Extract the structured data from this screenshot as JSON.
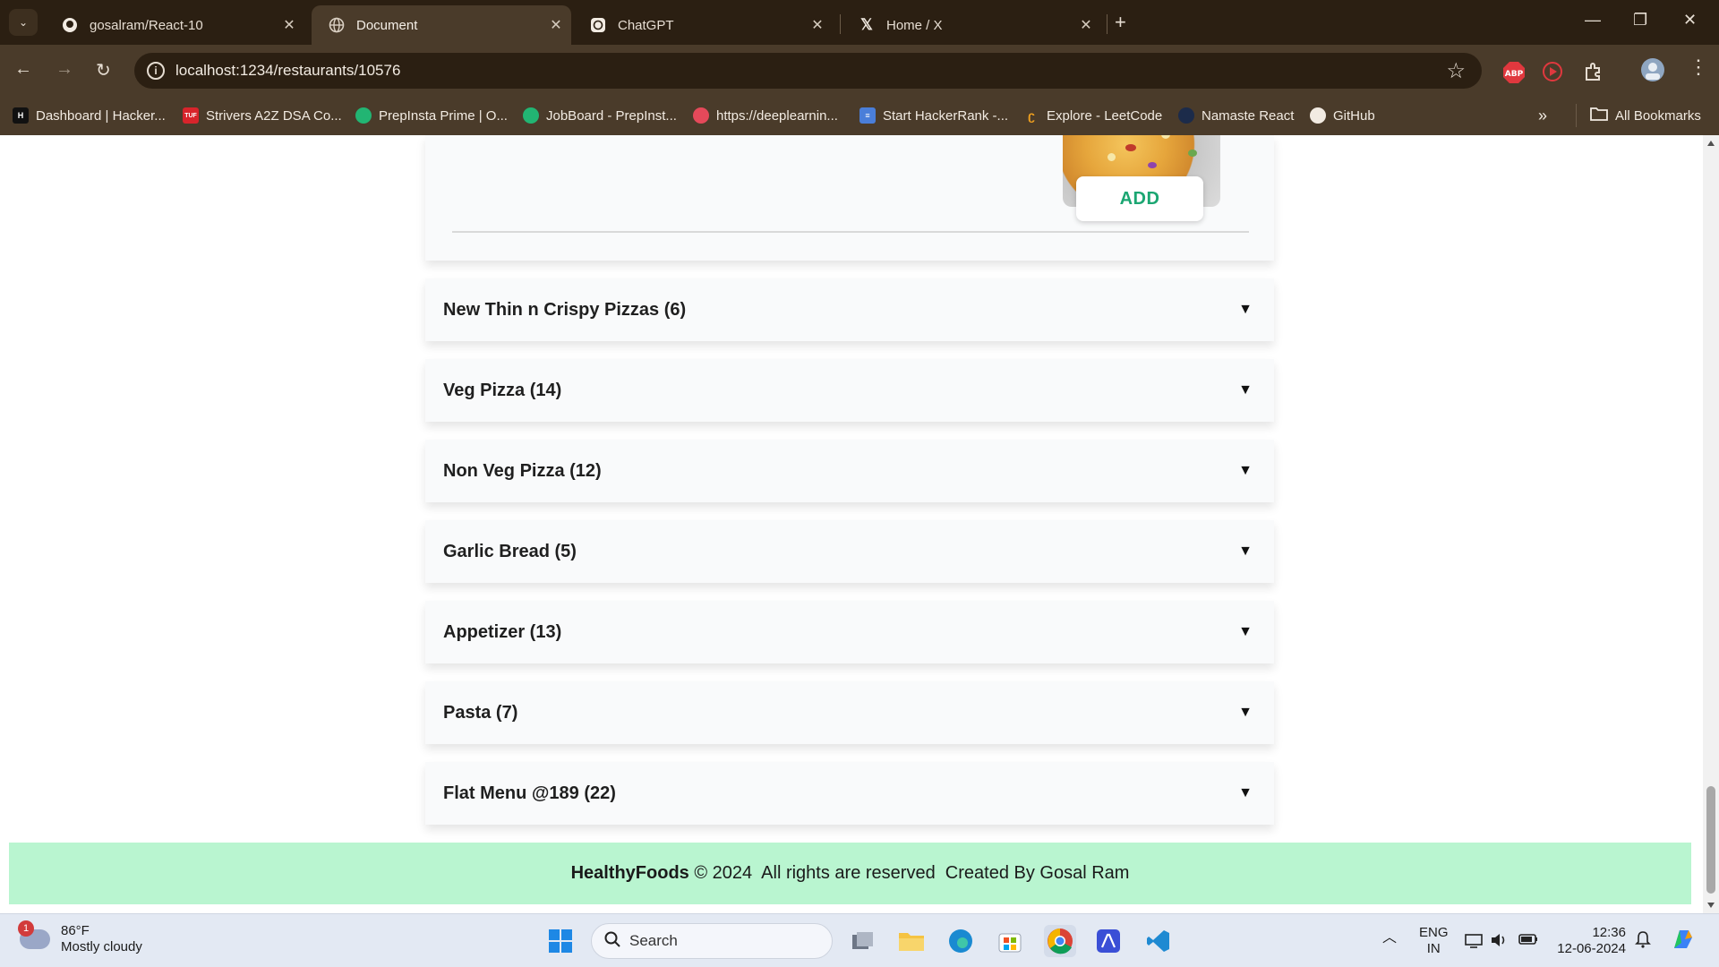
{
  "browser": {
    "tabs": [
      {
        "title": "gosalram/React-10",
        "icon": "github-icon",
        "active": false
      },
      {
        "title": "Document",
        "icon": "globe-icon",
        "active": true
      },
      {
        "title": "ChatGPT",
        "icon": "chatgpt-icon",
        "active": false
      },
      {
        "title": "Home / X",
        "icon": "x-icon",
        "active": false
      }
    ],
    "url": "localhost:1234/restaurants/10576",
    "bookmarks": [
      {
        "label": "Dashboard | Hacker...",
        "icon": "hackerrank-icon"
      },
      {
        "label": "Strivers A2Z DSA Co...",
        "icon": "takeuforward-icon"
      },
      {
        "label": "PrepInsta Prime | O...",
        "icon": "prepinsta-icon"
      },
      {
        "label": "JobBoard - PrepInst...",
        "icon": "prepinsta-icon"
      },
      {
        "label": "https://deeplearnin...",
        "icon": "deeplearning-icon"
      },
      {
        "label": "Start HackerRank -...",
        "icon": "doc-icon"
      },
      {
        "label": "Explore - LeetCode",
        "icon": "leetcode-icon"
      },
      {
        "label": "Namaste React",
        "icon": "namaste-icon"
      },
      {
        "label": "GitHub",
        "icon": "github-icon"
      }
    ],
    "all_bookmarks": "All Bookmarks"
  },
  "page": {
    "add_button": "ADD",
    "categories": [
      {
        "title": "New Thin n Crispy Pizzas (6)"
      },
      {
        "title": "Veg Pizza (14)"
      },
      {
        "title": "Non Veg Pizza (12)"
      },
      {
        "title": "Garlic Bread (5)"
      },
      {
        "title": "Appetizer (13)"
      },
      {
        "title": "Pasta (7)"
      },
      {
        "title": "Flat Menu @189 (22)"
      }
    ],
    "footer": {
      "brand": "HealthyFoods",
      "text": " © 2024  All rights are reserved  Created By Gosal Ram"
    },
    "accent_color": "#1ba672",
    "footer_color": "#b9f5d0"
  },
  "taskbar": {
    "weather_temp": "86°F",
    "weather_desc": "Mostly cloudy",
    "weather_badge": "1",
    "search_placeholder": "Search",
    "lang_line1": "ENG",
    "lang_line2": "IN",
    "time": "12:36",
    "date": "12-06-2024"
  }
}
